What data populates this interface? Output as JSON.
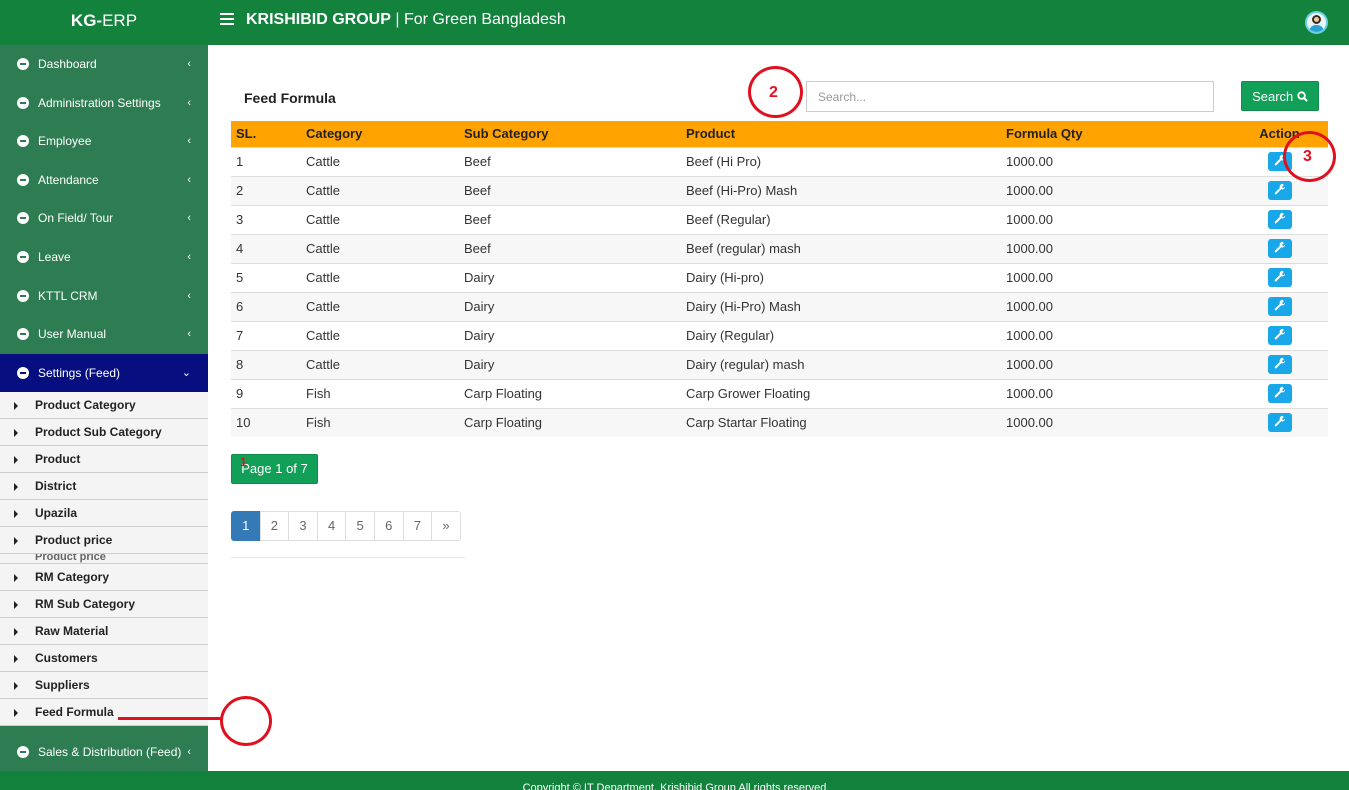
{
  "brand": {
    "bold": "KG-",
    "rest": "ERP"
  },
  "header": {
    "title_bold": "KRISHIBID GROUP",
    "title_sep": " | ",
    "title_rest": "For Green Bangladesh"
  },
  "sidebar": {
    "items": [
      {
        "label": "Dashboard",
        "chevron": "‹"
      },
      {
        "label": "Administration Settings",
        "chevron": "‹"
      },
      {
        "label": "Employee",
        "chevron": "‹"
      },
      {
        "label": "Attendance",
        "chevron": "‹"
      },
      {
        "label": "On Field/ Tour",
        "chevron": "‹"
      },
      {
        "label": "Leave",
        "chevron": "‹"
      },
      {
        "label": "KTTL CRM",
        "chevron": "‹"
      },
      {
        "label": "User Manual",
        "chevron": "‹"
      },
      {
        "label": "Settings (Feed)",
        "chevron": "⌄"
      }
    ],
    "submenu": [
      "Product Category",
      "Product Sub Category",
      "Product",
      "District",
      "Upazila",
      "Product price",
      "Product price",
      "RM Category",
      "RM Sub Category",
      "Raw Material",
      "Customers",
      "Suppliers",
      "Feed Formula"
    ],
    "bottom_item": {
      "label": "Sales & Distribution (Feed)",
      "chevron": "‹"
    }
  },
  "main": {
    "title": "Feed Formula",
    "search": {
      "placeholder": "Search...",
      "button_label": "Search"
    },
    "table": {
      "headers": [
        "SL.",
        "Category",
        "Sub Category",
        "Product",
        "Formula Qty",
        "Action"
      ],
      "rows": [
        [
          "1",
          "Cattle",
          "Beef",
          "Beef (Hi Pro)",
          "1000.00"
        ],
        [
          "2",
          "Cattle",
          "Beef",
          "Beef (Hi-Pro) Mash",
          "1000.00"
        ],
        [
          "3",
          "Cattle",
          "Beef",
          "Beef (Regular)",
          "1000.00"
        ],
        [
          "4",
          "Cattle",
          "Beef",
          "Beef (regular) mash",
          "1000.00"
        ],
        [
          "5",
          "Cattle",
          "Dairy",
          "Dairy (Hi-pro)",
          "1000.00"
        ],
        [
          "6",
          "Cattle",
          "Dairy",
          "Dairy (Hi-Pro) Mash",
          "1000.00"
        ],
        [
          "7",
          "Cattle",
          "Dairy",
          "Dairy (Regular)",
          "1000.00"
        ],
        [
          "8",
          "Cattle",
          "Dairy",
          "Dairy (regular) mash",
          "1000.00"
        ],
        [
          "9",
          "Fish",
          "Carp Floating",
          "Carp Grower Floating",
          "1000.00"
        ],
        [
          "10",
          "Fish",
          "Carp Floating",
          "Carp Startar Floating",
          "1000.00"
        ]
      ],
      "action_icon": "wrench-icon"
    },
    "page_info": "Page 1 of 7",
    "pagination": [
      "1",
      "2",
      "3",
      "4",
      "5",
      "6",
      "7",
      "»"
    ],
    "current_page": "1"
  },
  "annotations": {
    "marker_1": "1",
    "marker_2": "2",
    "marker_3": "3",
    "color": "#e0101e"
  },
  "footer": {
    "text": "Copyright © IT Department, Krishibid Group All rights reserved"
  },
  "colors": {
    "header": "#12823d",
    "sidebar": "#2e7d52",
    "active": "#070f80",
    "table_header": "#ffa300",
    "button": "#12a059",
    "edit": "#18a7e8"
  }
}
